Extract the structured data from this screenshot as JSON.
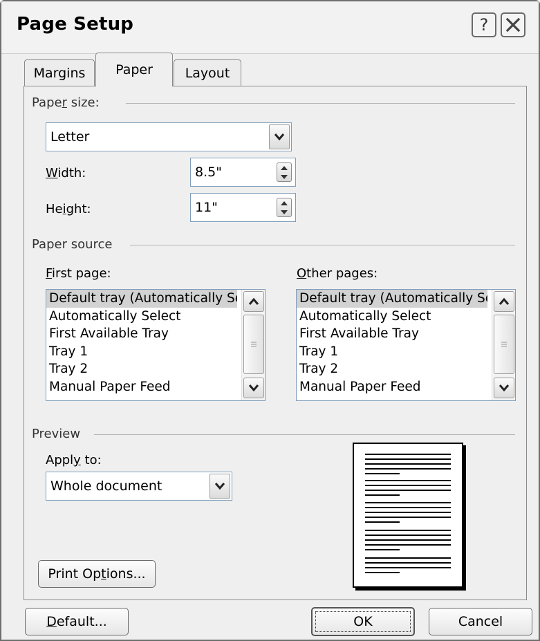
{
  "window": {
    "title": "Page Setup",
    "help_glyph": "?",
    "close_icon": "close-icon"
  },
  "tabs": [
    {
      "label": "Margins",
      "active": false
    },
    {
      "label": "Paper",
      "active": true
    },
    {
      "label": "Layout",
      "active": false
    }
  ],
  "paper_size": {
    "group_label_pre": "Pape",
    "group_label_accel": "r",
    "group_label_post": " size:",
    "selected": "Letter",
    "width_label_accel": "W",
    "width_label_rest": "idth:",
    "width_value": "8.5\"",
    "height_label_pre": "He",
    "height_label_accel": "i",
    "height_label_post": "ght:",
    "height_value": "11\""
  },
  "paper_source": {
    "group_label": "Paper source",
    "first_page_label_accel": "F",
    "first_page_label_rest": "irst page:",
    "other_pages_label_accel": "O",
    "other_pages_label_rest": "ther pages:",
    "first_page_items": [
      "Default tray (Automatically Select)",
      "Automatically Select",
      "First Available Tray",
      "Tray 1",
      "Tray 2",
      "Manual Paper Feed"
    ],
    "other_pages_items": [
      "Default tray (Automatically Select)",
      "Automatically Select",
      "First Available Tray",
      "Tray 1",
      "Tray 2",
      "Manual Paper Feed"
    ],
    "selected_index": 0
  },
  "preview": {
    "group_label": "Preview",
    "apply_to_label_pre": "Appl",
    "apply_to_label_accel": "y",
    "apply_to_label_post": " to:",
    "apply_to_value": "Whole document",
    "print_options_pre": "Print Op",
    "print_options_accel": "t",
    "print_options_post": "ions..."
  },
  "buttons": {
    "default_accel": "D",
    "default_rest": "efault...",
    "ok": "OK",
    "cancel": "Cancel"
  },
  "colors": {
    "dialog_bg": "#efefef",
    "selection": "#d2d2d2",
    "field_border": "#7f9db9"
  }
}
